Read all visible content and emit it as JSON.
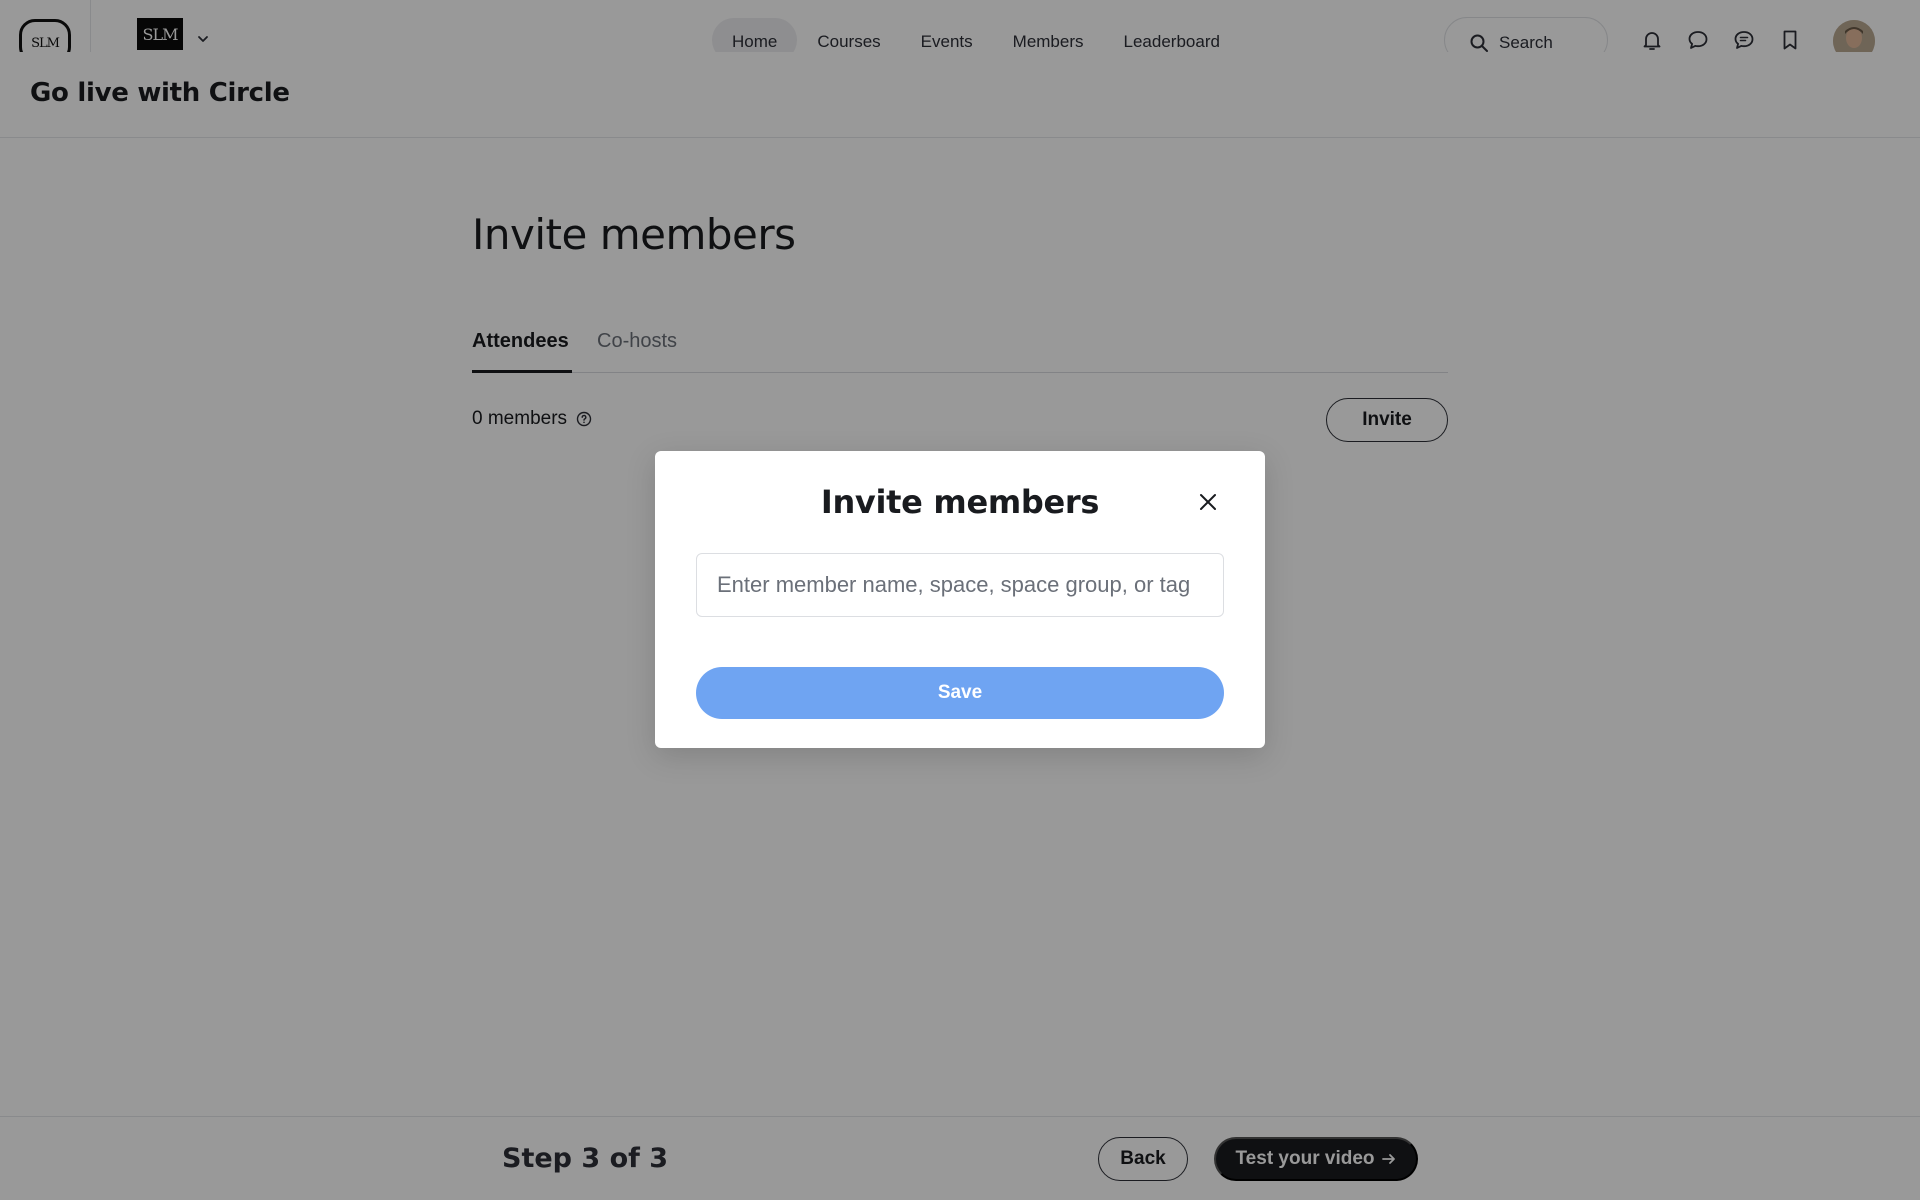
{
  "header": {
    "app_logo_text": "SLM",
    "community_logo_text": "SLM",
    "nav": [
      {
        "label": "Home",
        "active": true
      },
      {
        "label": "Courses",
        "active": false
      },
      {
        "label": "Events",
        "active": false
      },
      {
        "label": "Members",
        "active": false
      },
      {
        "label": "Leaderboard",
        "active": false
      }
    ],
    "search_label": "Search"
  },
  "page": {
    "title": "Go live with Circle",
    "heading": "Invite members",
    "tabs": [
      {
        "label": "Attendees",
        "active": true
      },
      {
        "label": "Co-hosts",
        "active": false
      }
    ],
    "members_count": "0 members",
    "invite_label": "Invite"
  },
  "footer": {
    "step_label": "Step 3 of 3",
    "back_label": "Back",
    "next_label": "Test your video"
  },
  "modal": {
    "title": "Invite members",
    "input_placeholder": "Enter member name, space, space group, or tag",
    "save_label": "Save"
  },
  "colors": {
    "accent": "#6fa4f2",
    "dark": "#191b1f"
  }
}
